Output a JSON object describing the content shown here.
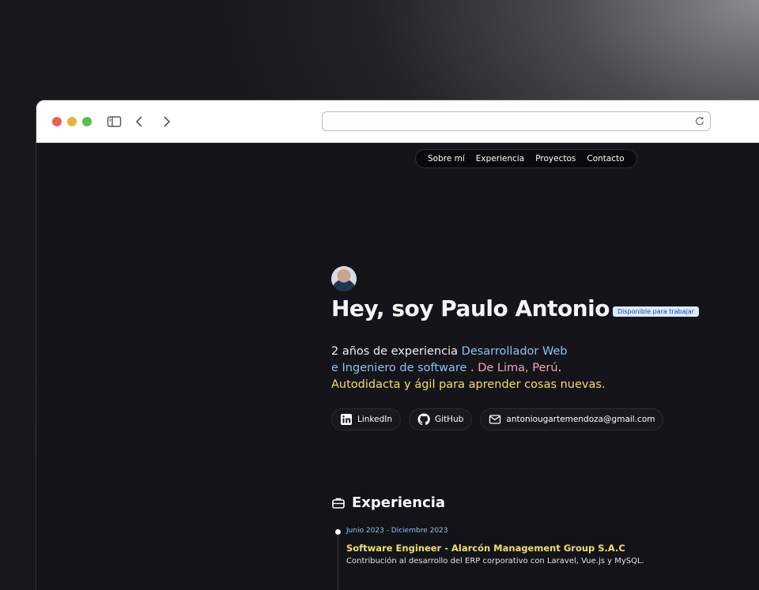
{
  "nav": {
    "items": [
      "Sobre mí",
      "Experiencia",
      "Proyectos",
      "Contacto"
    ]
  },
  "hero": {
    "title": "Hey, soy Paulo Antonio",
    "badge": "Disponible para trabajar",
    "intro": {
      "part1": "2 años de experiencia ",
      "part2": "Desarrollador Web",
      "part3": "e Ingeniero de software",
      "part4": " . ",
      "part5": "De Lima, Perú",
      "part6": ".",
      "part7": "Autodidacta y ágil para aprender cosas nuevas."
    }
  },
  "contacts": {
    "linkedin": "LinkedIn",
    "github": "GitHub",
    "email": "antoniougartemendoza@gmail.com"
  },
  "experience": {
    "title": "Experiencia",
    "items": [
      {
        "date": "Junio 2023 - Diciembre 2023",
        "role": "Software Engineer - Alarcón Management Group S.A.C",
        "description": "Contribución al desarrollo del ERP corporativo con Laravel, Vue.js y MySQL."
      }
    ]
  },
  "colors": {
    "accent_blue": "#8ec3ec",
    "accent_pink": "#f7a3b4",
    "accent_yellow": "#f4df6b",
    "badge_bg": "#dbeafe"
  },
  "icons": [
    "sidebar-icon",
    "back-icon",
    "forward-icon",
    "reload-icon",
    "linkedin-icon",
    "github-icon",
    "mail-icon",
    "briefcase-icon"
  ]
}
